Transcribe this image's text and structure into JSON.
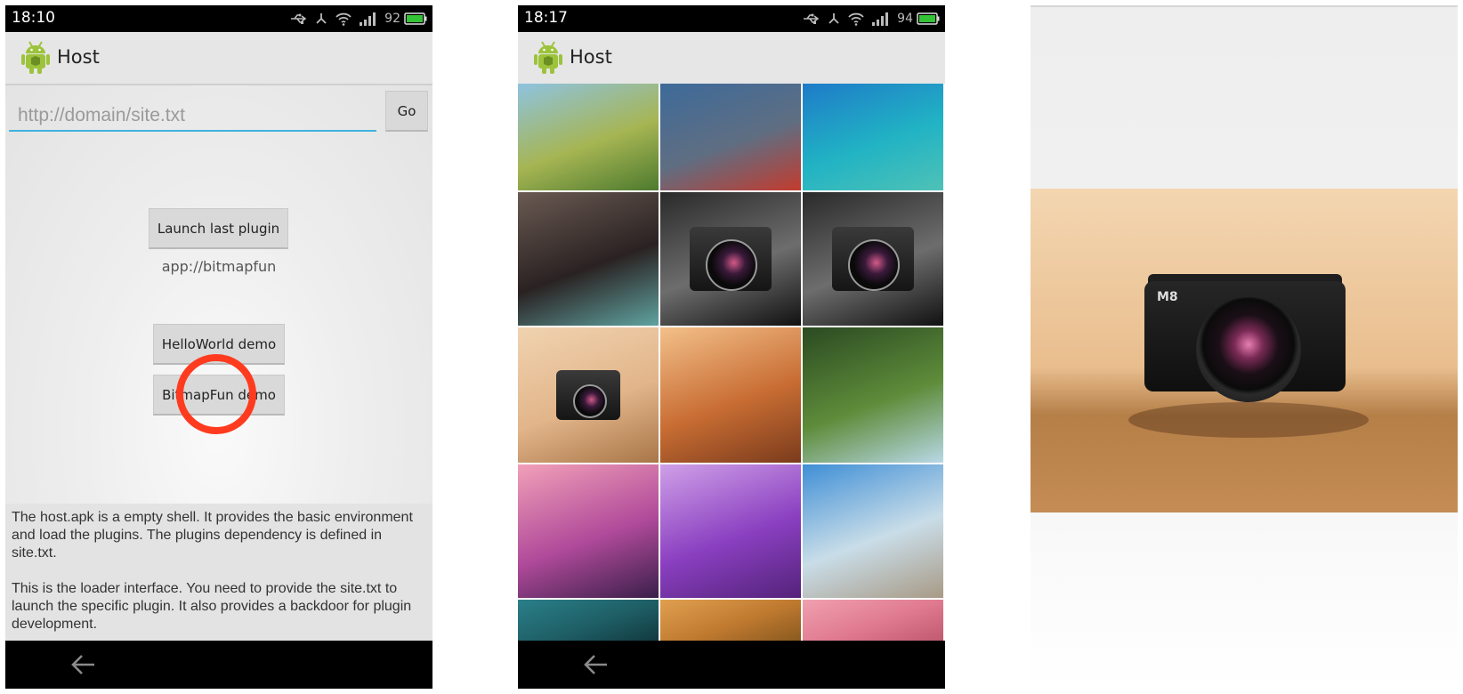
{
  "screen1": {
    "status": {
      "time": "18:10",
      "battery": "92"
    },
    "actionbar": {
      "title": "Host"
    },
    "url_input": {
      "value": "",
      "placeholder": "http://domain/site.txt"
    },
    "go_button": "Go",
    "launch_button": "Launch last plugin",
    "last_plugin": "app://bitmapfun",
    "helloworld_button": "HelloWorld demo",
    "bitmapfun_button": "BitmapFun demo",
    "info": [
      "The host.apk is a empty shell. It provides the basic environment and load the plugins. The plugins dependency is defined in site.txt.",
      "This is the loader interface. You need to provide the site.txt to launch the specific plugin. It also provides a backdoor for plugin development."
    ]
  },
  "screen2": {
    "status": {
      "time": "18:17",
      "battery": "94"
    },
    "actionbar": {
      "title": "Host"
    },
    "thumbnails": [
      {
        "name": "aerial-coast",
        "colors": [
          "#8ec3e0",
          "#a6b553",
          "#4d7a2e"
        ]
      },
      {
        "name": "aerial-city",
        "colors": [
          "#3d6a9a",
          "#5f6e82",
          "#c33b2e"
        ]
      },
      {
        "name": "turquoise-lagoon",
        "colors": [
          "#1e7bc8",
          "#21b3c4",
          "#4fc2b6"
        ]
      },
      {
        "name": "lava-coast",
        "colors": [
          "#6a5a52",
          "#2a2222",
          "#5fa3a0"
        ]
      },
      {
        "name": "camera-front",
        "colors": [
          "#2a2a2a",
          "#6d6d6d",
          "#111111"
        ]
      },
      {
        "name": "camera-front",
        "colors": [
          "#2a2a2a",
          "#6d6d6d",
          "#111111"
        ]
      },
      {
        "name": "camera-table",
        "colors": [
          "#f0d3b0",
          "#e2b58a",
          "#a87648"
        ]
      },
      {
        "name": "sandstone-canyon",
        "colors": [
          "#f3c08a",
          "#c86d33",
          "#7a3b1c"
        ]
      },
      {
        "name": "waterfall",
        "colors": [
          "#2b4a22",
          "#5e8c3a",
          "#b8d8e6"
        ]
      },
      {
        "name": "purple-mountains",
        "colors": [
          "#f1a0b8",
          "#b04a9a",
          "#3a1f4a"
        ]
      },
      {
        "name": "purple-stream",
        "colors": [
          "#cfa0e8",
          "#8a3fc0",
          "#54237a"
        ]
      },
      {
        "name": "telescope-city",
        "colors": [
          "#3f8fd6",
          "#c9dde8",
          "#a89a86"
        ]
      },
      {
        "name": "teal-partial",
        "colors": [
          "#2a7f8a",
          "#1f5f66",
          "#123a40"
        ]
      },
      {
        "name": "orange-partial",
        "colors": [
          "#e0a050",
          "#c07a30",
          "#8a5a20"
        ]
      },
      {
        "name": "pink-partial",
        "colors": [
          "#f0a0b0",
          "#e07a90",
          "#c05a70"
        ]
      }
    ]
  },
  "screen3": {
    "photo": {
      "name": "leica-camera",
      "label": "M8"
    }
  }
}
